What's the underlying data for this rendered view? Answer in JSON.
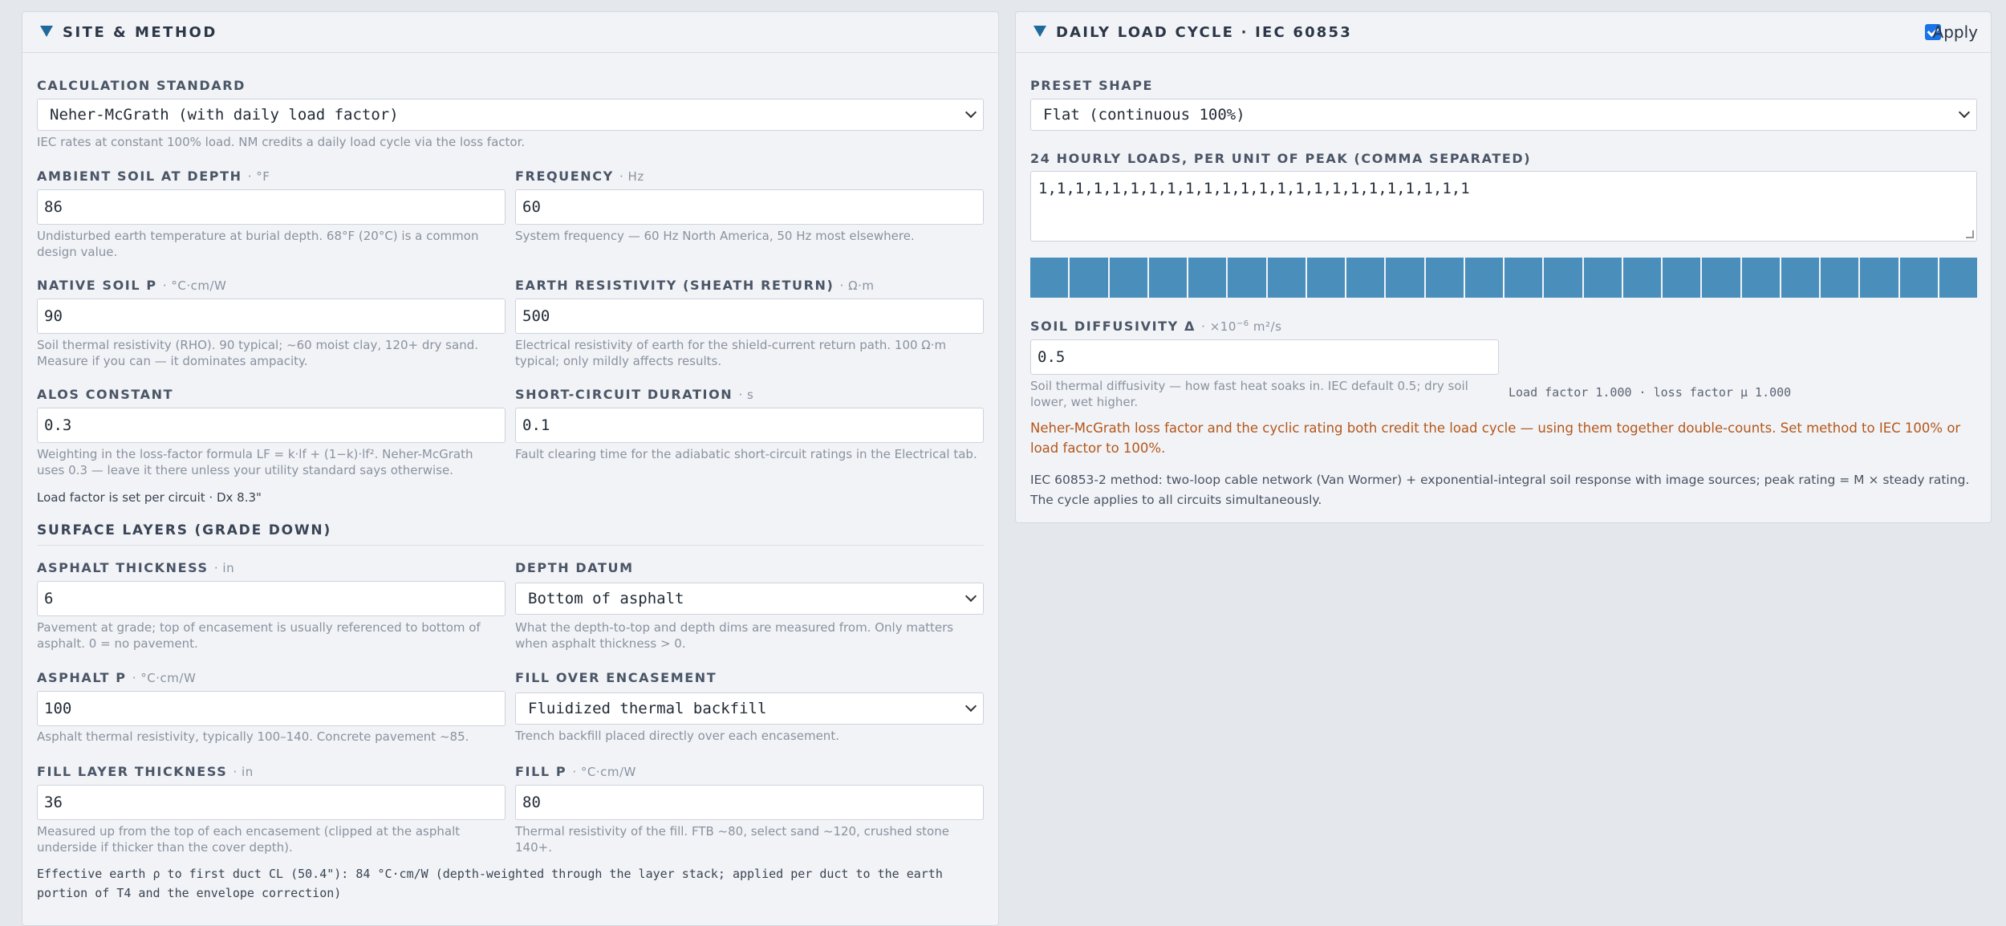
{
  "site": {
    "title": "SITE & METHOD",
    "standard": {
      "label": "CALCULATION STANDARD",
      "value": "Neher-McGrath (with daily load factor)",
      "help": "IEC rates at constant 100% load. NM credits a daily load cycle via the loss factor."
    },
    "ambient": {
      "label": "AMBIENT SOIL AT DEPTH",
      "unit": "· °F",
      "value": "86",
      "help": "Undisturbed earth temperature at burial depth. 68°F (20°C) is a common design value."
    },
    "frequency": {
      "label": "FREQUENCY",
      "unit": "· Hz",
      "value": "60",
      "help": "System frequency — 60 Hz North America, 50 Hz most elsewhere."
    },
    "native_rho": {
      "label": "NATIVE SOIL Ρ",
      "unit": "· °C·cm/W",
      "value": "90",
      "help": "Soil thermal resistivity (RHO). 90 typical; ~60 moist clay, 120+ dry sand. Measure if you can — it dominates ampacity."
    },
    "earth_res": {
      "label": "EARTH RESISTIVITY (SHEATH RETURN)",
      "unit": "· Ω·m",
      "value": "500",
      "help": "Electrical resistivity of earth for the shield-current return path. 100 Ω·m typical; only mildly affects results."
    },
    "alos": {
      "label": "ALOS CONSTANT",
      "value": "0.3",
      "help": "Weighting in the loss-factor formula LF = k·lf + (1−k)·lf². Neher-McGrath uses 0.3 — leave it there unless your utility standard says otherwise."
    },
    "short_circuit": {
      "label": "SHORT-CIRCUIT DURATION",
      "unit": "· s",
      "value": "0.1",
      "help": "Fault clearing time for the adiabatic short-circuit ratings in the Electrical tab."
    },
    "load_note": "Load factor is set per circuit · Dx 8.3\"",
    "surface_title": "SURFACE LAYERS (GRADE DOWN)",
    "asphalt_thickness": {
      "label": "ASPHALT THICKNESS",
      "unit": "· in",
      "value": "6",
      "help": "Pavement at grade; top of encasement is usually referenced to bottom of asphalt. 0 = no pavement."
    },
    "depth_datum": {
      "label": "DEPTH DATUM",
      "value": "Bottom of asphalt",
      "help": "What the depth-to-top and depth dims are measured from. Only matters when asphalt thickness > 0."
    },
    "asphalt_rho": {
      "label": "ASPHALT Ρ",
      "unit": "· °C·cm/W",
      "value": "100",
      "help": "Asphalt thermal resistivity, typically 100–140. Concrete pavement ~85."
    },
    "fill_over": {
      "label": "FILL OVER ENCASEMENT",
      "value": "Fluidized thermal backfill",
      "help": "Trench backfill placed directly over each encasement."
    },
    "fill_thickness": {
      "label": "FILL LAYER THICKNESS",
      "unit": "· in",
      "value": "36",
      "help": "Measured up from the top of each encasement (clipped at the asphalt underside if thicker than the cover depth)."
    },
    "fill_rho": {
      "label": "FILL Ρ",
      "unit": "· °C·cm/W",
      "value": "80",
      "help": "Thermal resistivity of the fill. FTB ~80, select sand ~120, crushed stone 140+."
    },
    "effective": "Effective earth ρ to first duct CL (50.4\"): 84 °C·cm/W (depth-weighted through the layer stack; applied per duct to the earth portion of T4 and the envelope correction)"
  },
  "cycle": {
    "title": "DAILY LOAD CYCLE · IEC 60853",
    "apply_label": "Apply",
    "apply_checked": true,
    "preset": {
      "label": "PRESET SHAPE",
      "value": "Flat (continuous 100%)"
    },
    "hourly": {
      "label": "24 HOURLY LOADS, PER UNIT OF PEAK (COMMA SEPARATED)",
      "value": "1,1,1,1,1,1,1,1,1,1,1,1,1,1,1,1,1,1,1,1,1,1,1,1"
    },
    "hourly_values": [
      1,
      1,
      1,
      1,
      1,
      1,
      1,
      1,
      1,
      1,
      1,
      1,
      1,
      1,
      1,
      1,
      1,
      1,
      1,
      1,
      1,
      1,
      1,
      1
    ],
    "bar_color": "#4a8fbb",
    "diffusivity": {
      "label": "SOIL DIFFUSIVITY Δ",
      "unit_prefix": "· ×10",
      "unit_exp": "−6",
      "unit_suffix": " m²/s",
      "value": "0.5",
      "help": "Soil thermal diffusivity — how fast heat soaks in. IEC default 0.5; dry soil lower, wet higher."
    },
    "factors": "Load factor 1.000 · loss factor μ 1.000",
    "warning": "Neher-McGrath loss factor and the cyclic rating both credit the load cycle — using them together double-counts. Set method to IEC 100% or load factor to 100%.",
    "method_note": "IEC 60853-2 method: two-loop cable network (Van Wormer) + exponential-integral soil response with image sources; peak rating = M × steady rating. The cycle applies to all circuits simultaneously."
  }
}
